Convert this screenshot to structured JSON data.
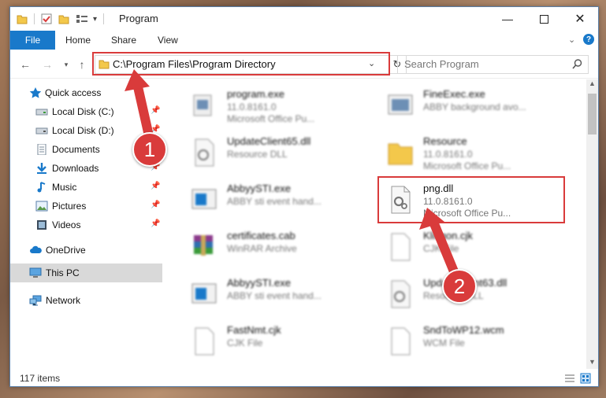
{
  "window": {
    "title": "Program"
  },
  "ribbon": {
    "file": "File",
    "tabs": [
      "Home",
      "Share",
      "View"
    ]
  },
  "address": {
    "path": "C:\\Program Files\\Program Directory"
  },
  "search": {
    "placeholder": "Search Program"
  },
  "sidebar": {
    "items": [
      {
        "label": "Quick access",
        "icon": "star-icon"
      },
      {
        "label": "Local Disk (C:)",
        "icon": "drive-icon",
        "pinned": true
      },
      {
        "label": "Local Disk (D:)",
        "icon": "drive-icon",
        "pinned": true
      },
      {
        "label": "Documents",
        "icon": "documents-icon",
        "pinned": true
      },
      {
        "label": "Downloads",
        "icon": "downloads-icon",
        "pinned": true
      },
      {
        "label": "Music",
        "icon": "music-icon",
        "pinned": true
      },
      {
        "label": "Pictures",
        "icon": "pictures-icon",
        "pinned": true
      },
      {
        "label": "Videos",
        "icon": "videos-icon",
        "pinned": true
      },
      {
        "label": "OneDrive",
        "icon": "cloud-icon"
      },
      {
        "label": "This PC",
        "icon": "computer-icon",
        "selected": true
      },
      {
        "label": "Network",
        "icon": "network-icon"
      }
    ]
  },
  "files": [
    {
      "name": "program.exe",
      "version": "11.0.8161.0",
      "desc": "Microsoft Office Pu...",
      "icon": "exe-icon"
    },
    {
      "name": "FineExec.exe",
      "version": "ABBY background avo...",
      "desc": "",
      "icon": "app-icon"
    },
    {
      "name": "UpdateClient65.dll",
      "version": "Resource DLL",
      "desc": "",
      "icon": "dll-icon"
    },
    {
      "name": "Resource",
      "version": "11.0.8161.0",
      "desc": "Microsoft Office Pu...",
      "icon": "folder-icon"
    },
    {
      "name": "AbbyySTI.exe",
      "version": "ABBY sti event hand...",
      "desc": "",
      "icon": "app-icon"
    },
    {
      "name": "png.dll",
      "version": "11.0.8161.0",
      "desc": "Microsoft Office Pu...",
      "icon": "dll-icon"
    },
    {
      "name": "certificates.cab",
      "version": "WinRAR Archive",
      "desc": "",
      "icon": "archive-icon"
    },
    {
      "name": "Klingon.cjk",
      "version": "CJK File",
      "desc": "",
      "icon": "file-icon"
    },
    {
      "name": "AbbyySTI.exe",
      "version": "ABBY sti event hand...",
      "desc": "",
      "icon": "app-icon"
    },
    {
      "name": "UpdateClient63.dll",
      "version": "Resource DLL",
      "desc": "",
      "icon": "dll-icon"
    },
    {
      "name": "FastNmt.cjk",
      "version": "CJK File",
      "desc": "",
      "icon": "file-icon"
    },
    {
      "name": "SndToWP12.wcm",
      "version": "WCM File",
      "desc": "",
      "icon": "file-icon"
    }
  ],
  "status": {
    "count": "117 items"
  },
  "annotations": {
    "step1": "1",
    "step2": "2",
    "accent": "#d93b3b"
  }
}
